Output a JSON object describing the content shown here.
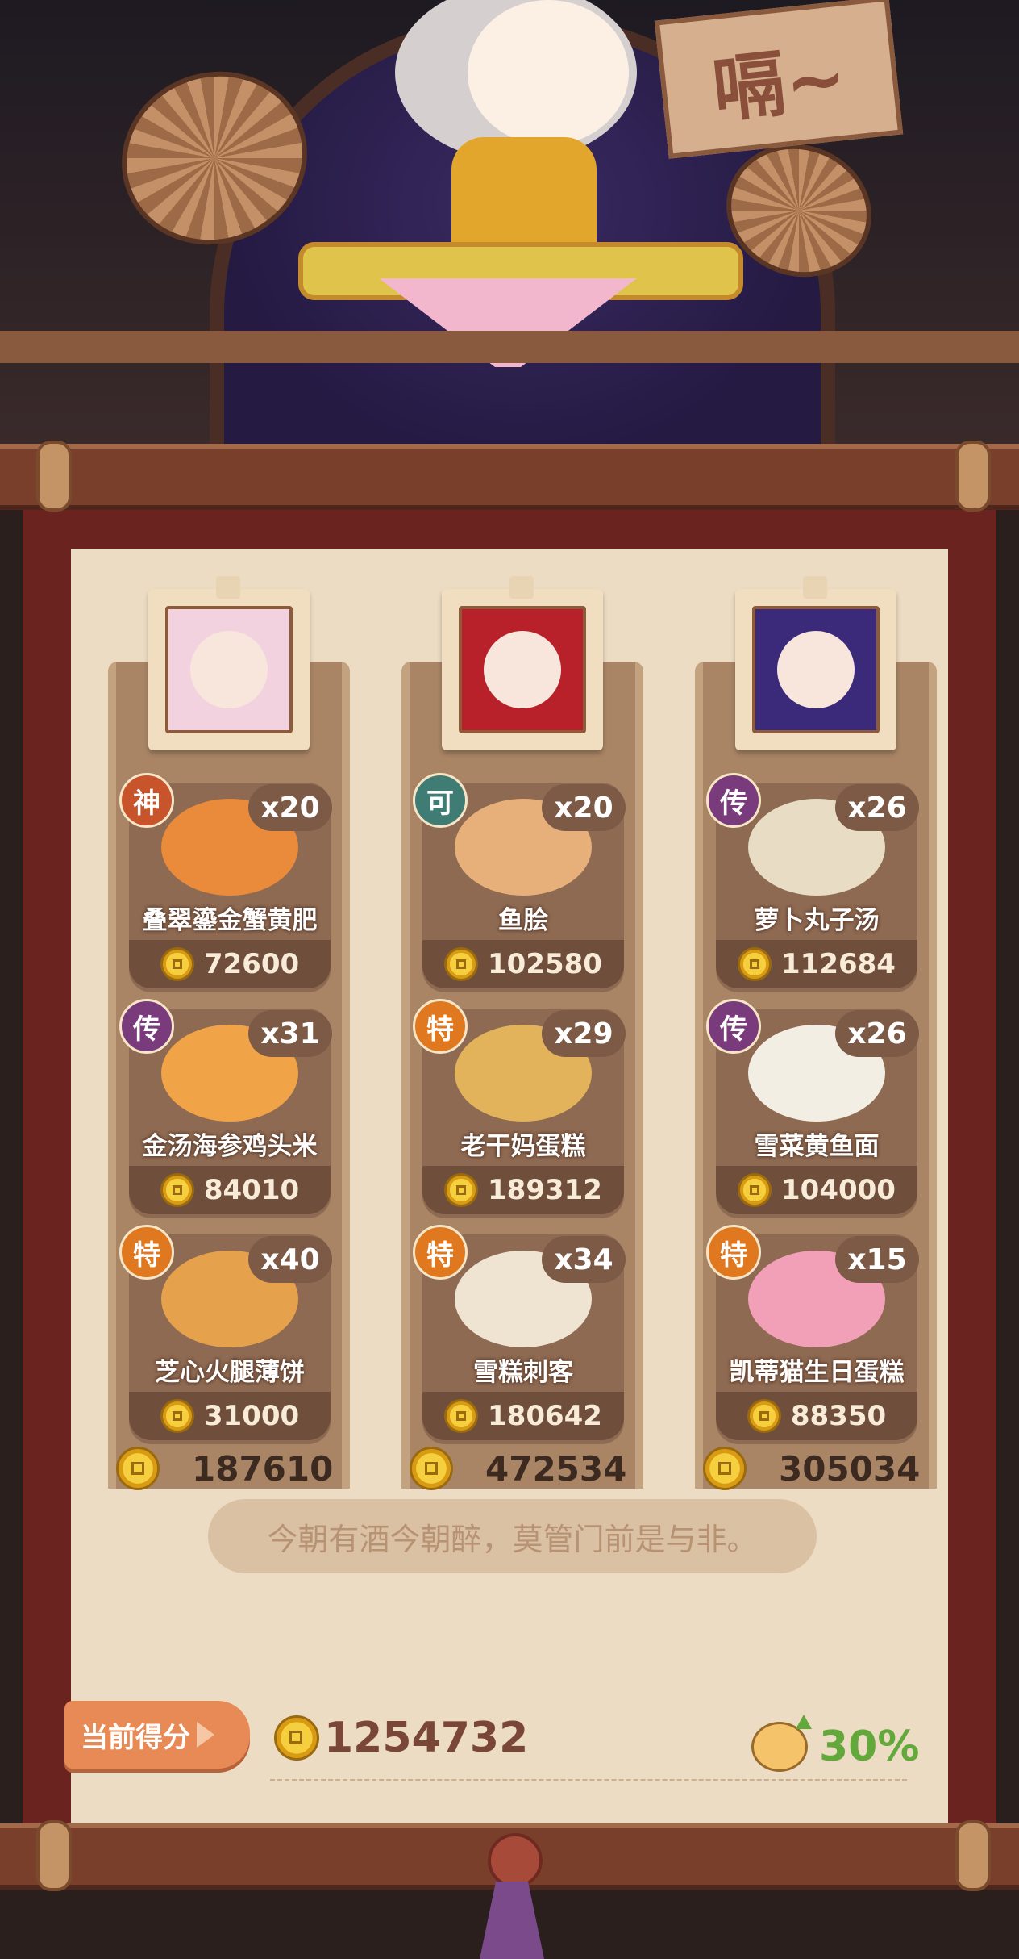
{
  "header": {
    "sign_text": "嗝~"
  },
  "columns": [
    {
      "character": "purple-hair-chef",
      "dishes": [
        {
          "badge": "神",
          "badge_color": "#c8542c",
          "count": "x20",
          "name": "叠翠鎏金蟹黄肥",
          "price": "72600",
          "food_color": "#e98b3a"
        },
        {
          "badge": "传",
          "badge_color": "#7a3b7c",
          "count": "x31",
          "name": "金汤海参鸡头米",
          "price": "84010",
          "food_color": "#f0a347"
        },
        {
          "badge": "特",
          "badge_color": "#e0781f",
          "count": "x40",
          "name": "芝心火腿薄饼",
          "price": "31000",
          "food_color": "#e6a14c"
        }
      ],
      "total": "187610"
    },
    {
      "character": "red-hair-chef",
      "dishes": [
        {
          "badge": "可",
          "badge_color": "#3f7d74",
          "count": "x20",
          "name": "鱼脍",
          "price": "102580",
          "food_color": "#e7b07a"
        },
        {
          "badge": "特",
          "badge_color": "#e0781f",
          "count": "x29",
          "name": "老干妈蛋糕",
          "price": "189312",
          "food_color": "#e2b35a"
        },
        {
          "badge": "特",
          "badge_color": "#e0781f",
          "count": "x34",
          "name": "雪糕刺客",
          "price": "180642",
          "food_color": "#efe4d2"
        }
      ],
      "total": "472534"
    },
    {
      "character": "brown-hair-chef",
      "dishes": [
        {
          "badge": "传",
          "badge_color": "#7a3b7c",
          "count": "x26",
          "name": "萝卜丸子汤",
          "price": "112684",
          "food_color": "#e8dcc4"
        },
        {
          "badge": "传",
          "badge_color": "#7a3b7c",
          "count": "x26",
          "name": "雪菜黄鱼面",
          "price": "104000",
          "food_color": "#f3eee3"
        },
        {
          "badge": "特",
          "badge_color": "#e0781f",
          "count": "x15",
          "name": "凯蒂猫生日蛋糕",
          "price": "88350",
          "food_color": "#f2a0b8"
        }
      ],
      "total": "305034"
    }
  ],
  "quote": "今朝有酒今朝醉，莫管门前是与非。",
  "score": {
    "label": "当前得分",
    "value": "1254732",
    "bonus": "30%"
  }
}
